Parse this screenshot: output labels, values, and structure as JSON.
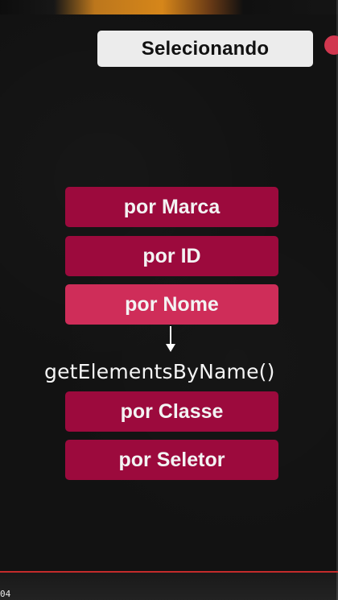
{
  "title": "Selecionando",
  "buttons": [
    {
      "label": "por Marca",
      "state": "normal"
    },
    {
      "label": "por ID",
      "state": "normal"
    },
    {
      "label": "por Nome",
      "state": "active"
    },
    {
      "label": "por Classe",
      "state": "normal"
    },
    {
      "label": "por Seletor",
      "state": "normal"
    }
  ],
  "method_label": "getElementsByName()",
  "player": {
    "time": "04"
  },
  "colors": {
    "background": "#121212",
    "title_bg": "#ececec",
    "button_dark": "#9c0a3d",
    "button_active": "#cf2d59",
    "accent_dot": "#d1374f",
    "progress": "#c42b2b"
  }
}
